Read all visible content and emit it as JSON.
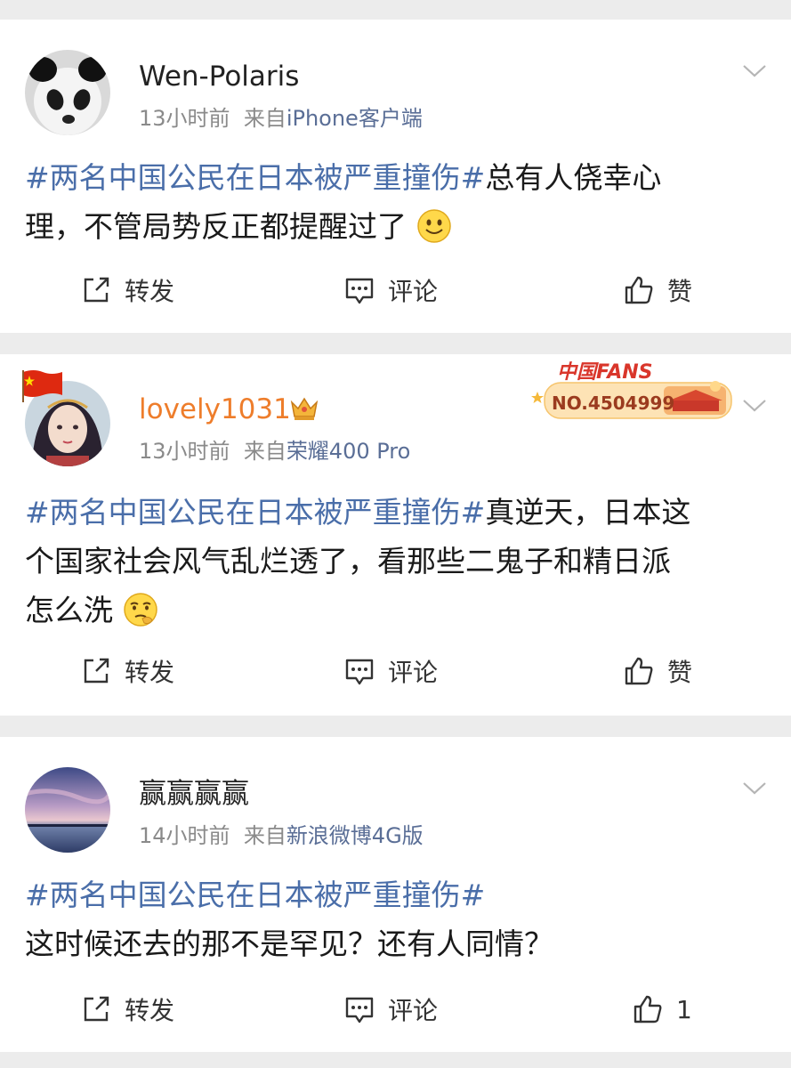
{
  "posts": [
    {
      "username": "Wen-Polaris",
      "time": "13小时前",
      "from_prefix": "来自",
      "source": "iPhone客户端",
      "topic": "#两名中国公民在日本被严重撞伤#",
      "body_line1": "总有人侥幸心",
      "body_line2": "理，不管局势反正都提醒过了",
      "emoji": "smile-emoji",
      "actions": {
        "repost": "转发",
        "comment": "评论",
        "like": "赞"
      }
    },
    {
      "username": "lovely1031",
      "time": "13小时前",
      "from_prefix": "来自",
      "source": "荣耀400 Pro",
      "badge": {
        "title": "中国FANS",
        "number": "NO.4504999"
      },
      "topic": "#两名中国公民在日本被严重撞伤#",
      "body_line1": "真逆天，日本这",
      "body_line2": "个国家社会风气乱烂透了，看那些二鬼子和精日派",
      "body_line3": "怎么洗",
      "emoji": "thinking-emoji",
      "actions": {
        "repost": "转发",
        "comment": "评论",
        "like": "赞"
      }
    },
    {
      "username": "赢赢赢赢",
      "time": "14小时前",
      "from_prefix": "来自",
      "source": "新浪微博4G版",
      "topic": "#两名中国公民在日本被严重撞伤#",
      "body_line2": "这时候还去的那不是罕见？还有人同情？",
      "actions": {
        "repost": "转发",
        "comment": "评论",
        "like": "1"
      }
    }
  ],
  "colors": {
    "topic": "#4a6ea9",
    "source": "#5a6e96",
    "vip_name": "#ee7d2b",
    "background": "#ececec"
  }
}
